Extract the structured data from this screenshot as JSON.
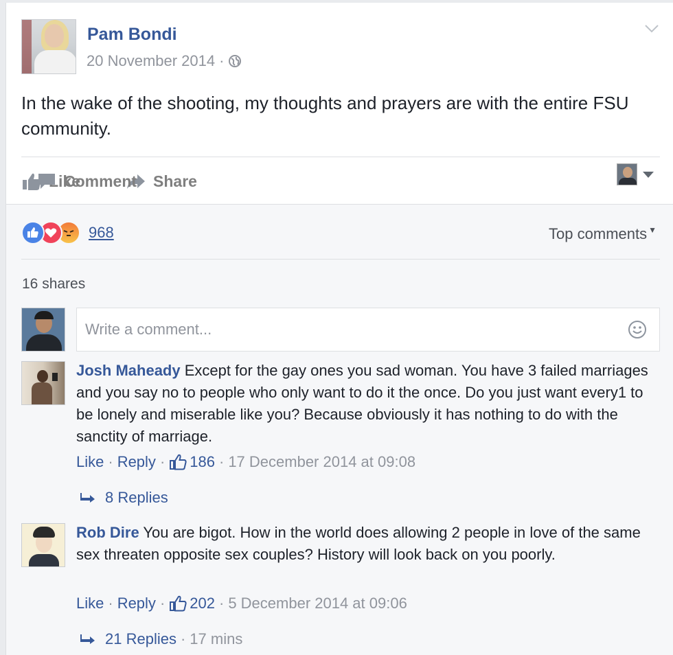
{
  "post": {
    "author": "Pam Bondi",
    "date": "20 November 2014",
    "meta_sep": "·",
    "privacy_icon": "globe-icon",
    "text": "In the wake of the shooting, my thoughts and prayers are with the entire FSU community."
  },
  "actions": {
    "like_label": "Like",
    "comment_label": "Comment",
    "share_label": "Share"
  },
  "reactions": {
    "types": [
      "like",
      "love",
      "angry"
    ],
    "count": "968",
    "sort_label": "Top comments"
  },
  "shares_label": "16 shares",
  "composer": {
    "placeholder": "Write a comment..."
  },
  "comments": [
    {
      "author": "Josh Mahead y",
      "author_display": "Josh Maheady",
      "text": " Except for the gay ones you sad woman. You have 3 failed marriages and you say no to people who only want to do it the once. Do you just want every1 to be lonely and miserable like you? Because obviously it has nothing to do with the sanctity of marriage.",
      "like_label": "Like",
      "reply_label": "Reply",
      "likes": "186",
      "timestamp": "17 December 2014 at 09:08",
      "replies_label": "8 Replies",
      "replies_time": ""
    },
    {
      "author_display": "Rob Dire",
      "text": " You are bigot. How in the world does allowing 2 people in love of the same sex threaten opposite sex couples? History will look back on you poorly.",
      "like_label": "Like",
      "reply_label": "Reply",
      "likes": "202",
      "timestamp": "5 December 2014 at 09:06",
      "replies_label": "21 Replies",
      "replies_time": "17 mins"
    }
  ],
  "colors": {
    "link": "#365899",
    "muted": "#90949c",
    "like_blue": "#4a83e6",
    "love_red": "#f0435a",
    "angry_orange": "#f27b3a"
  }
}
